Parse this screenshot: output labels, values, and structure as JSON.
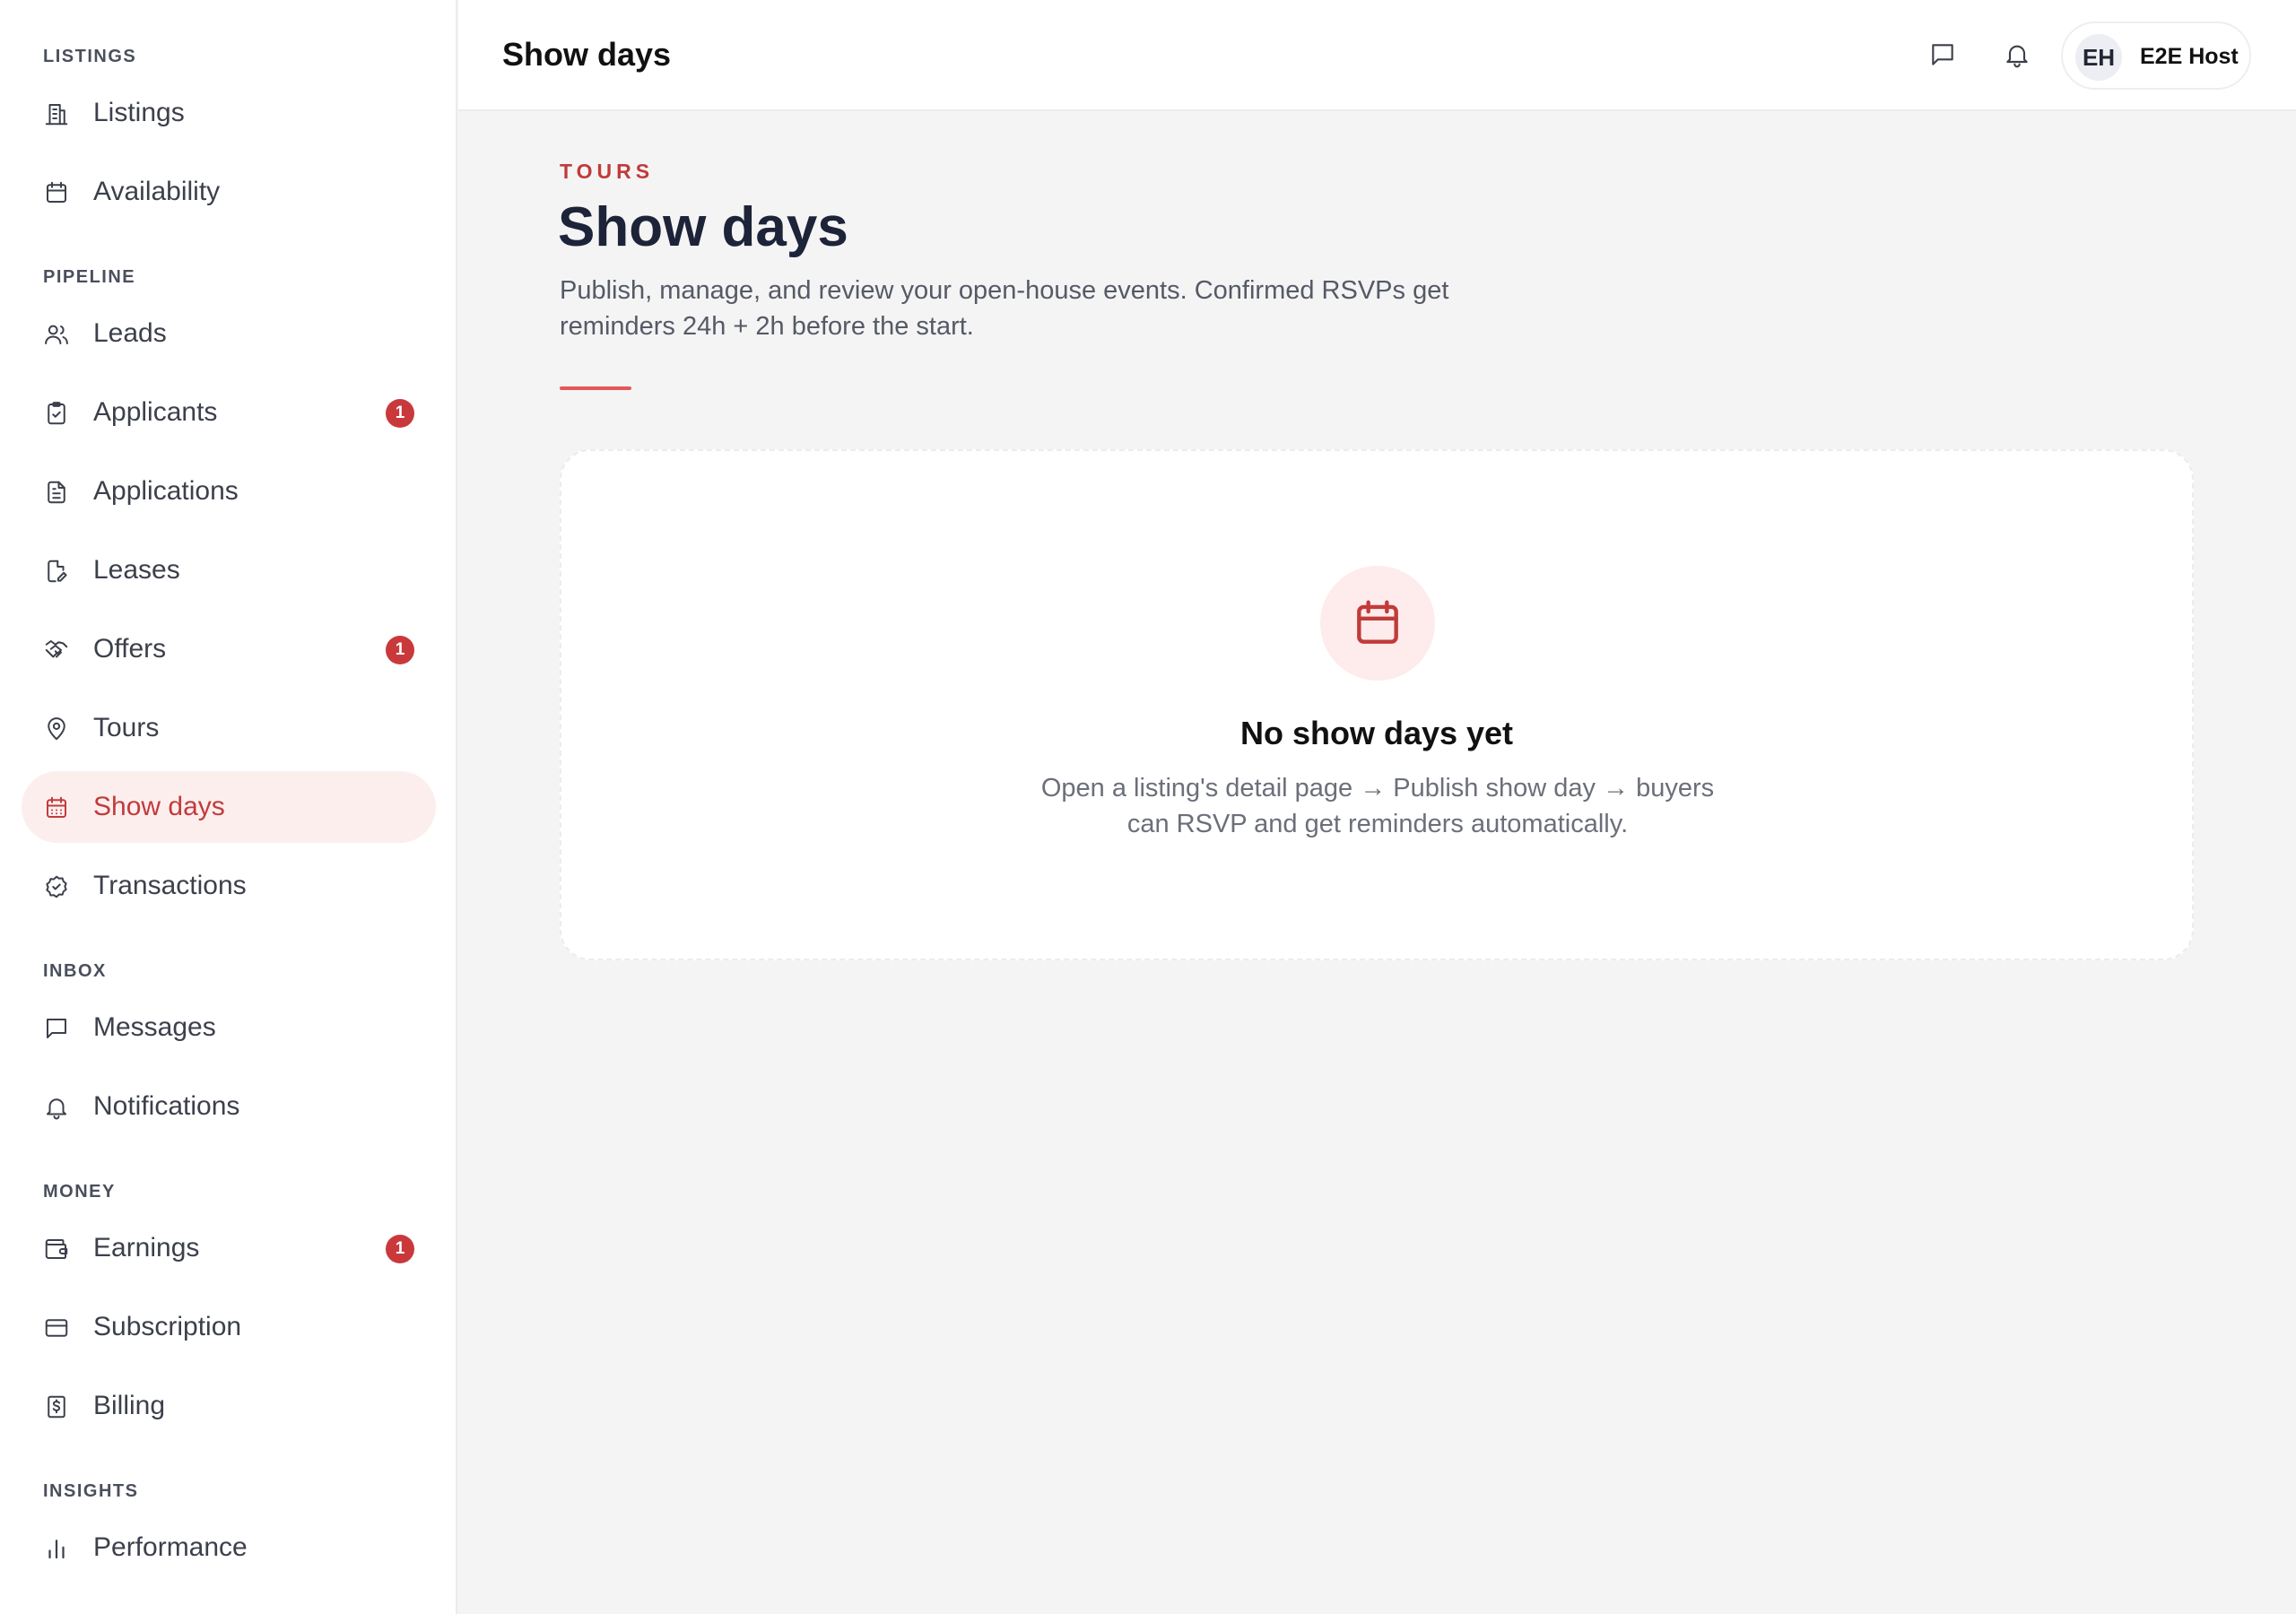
{
  "sidebar": {
    "sections": {
      "listings": "LISTINGS",
      "pipeline": "PIPELINE",
      "inbox": "INBOX",
      "money": "MONEY",
      "insights": "INSIGHTS"
    },
    "items": {
      "listings": "Listings",
      "availability": "Availability",
      "leads": "Leads",
      "applicants": "Applicants",
      "applications": "Applications",
      "leases": "Leases",
      "offers": "Offers",
      "tours": "Tours",
      "show_days": "Show days",
      "transactions": "Transactions",
      "messages": "Messages",
      "notifications": "Notifications",
      "earnings": "Earnings",
      "subscription": "Subscription",
      "billing": "Billing",
      "performance": "Performance"
    },
    "badges": {
      "applicants": "1",
      "offers": "1",
      "earnings": "1"
    },
    "active_item": "show_days"
  },
  "header": {
    "title": "Show days",
    "user": {
      "initials": "EH",
      "name": "E2E Host"
    }
  },
  "main": {
    "eyebrow": "TOURS",
    "title": "Show days",
    "description": "Publish, manage, and review your open-house events. Confirmed RSVPs get reminders 24h + 2h before the start.",
    "empty_state": {
      "icon": "calendar-icon",
      "title": "No show days yet",
      "description": "Open a listing's detail page → Publish show day → buyers can RSVP and get reminders automatically."
    }
  },
  "colors": {
    "accent": "#c13b3b",
    "accent_soft": "#fdeeee",
    "badge": "#c9393b",
    "heading": "#1d2338"
  }
}
